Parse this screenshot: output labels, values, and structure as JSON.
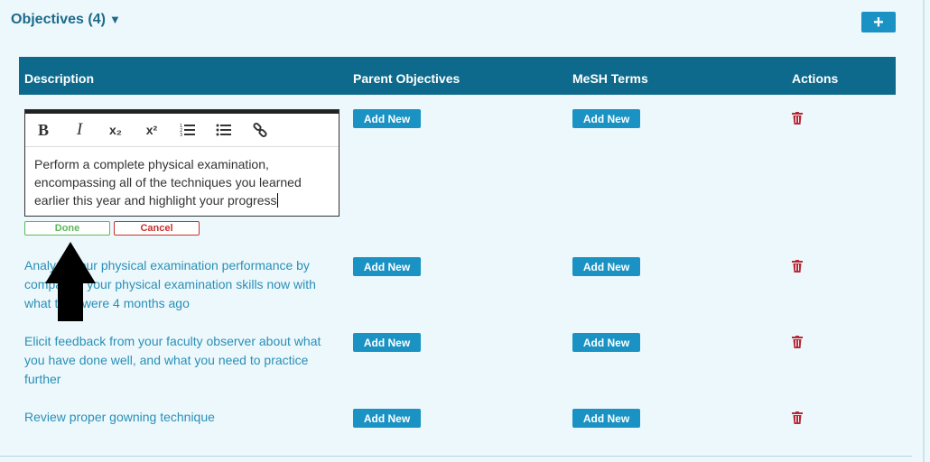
{
  "section": {
    "title": "Objectives (4)",
    "caret": "▼",
    "add_label": "+"
  },
  "table": {
    "headers": {
      "description": "Description",
      "parent": "Parent Objectives",
      "mesh": "MeSH Terms",
      "actions": "Actions"
    }
  },
  "editor": {
    "toolbar": {
      "bold": "B",
      "italic": "I",
      "subscript": "x₂",
      "superscript": "x²"
    },
    "text": "Perform a complete physical examination, encompassing all of the techniques you learned earlier this year and highlight your progress",
    "done_label": "Done",
    "cancel_label": "Cancel"
  },
  "rows": [
    {
      "description": "Analyze your physical examination performance by comparing your physical examination skills now with what they were 4 months ago",
      "parent_label": "Add New",
      "mesh_label": "Add New"
    },
    {
      "description": "Elicit feedback from your faculty observer about what you have done well, and what you need to practice further",
      "parent_label": "Add New",
      "mesh_label": "Add New"
    },
    {
      "description": "Review proper gowning technique",
      "parent_label": "Add New",
      "mesh_label": "Add New"
    }
  ],
  "first_row": {
    "parent_label": "Add New",
    "mesh_label": "Add New"
  },
  "colors": {
    "header_bg": "#0e6a8c",
    "button": "#1a93c4",
    "link": "#2a8fb7",
    "trash": "#b52a3a",
    "done": "#5cb85c",
    "cancel": "#c9302c"
  }
}
